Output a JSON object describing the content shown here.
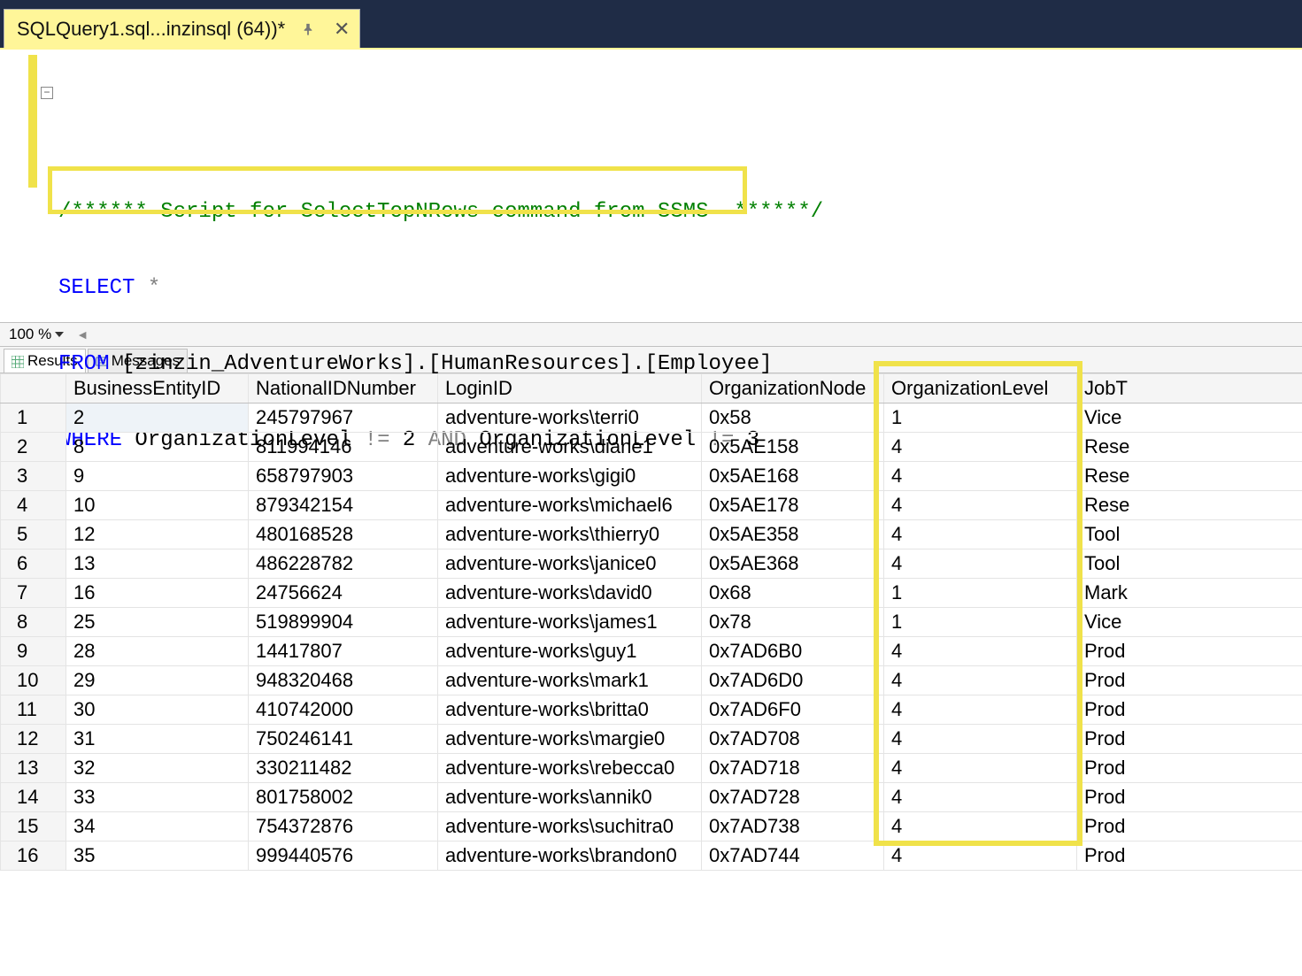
{
  "tab": {
    "title": "SQLQuery1.sql...inzinsql (64))*"
  },
  "editor": {
    "comment": "/****** Script for SelectTopNRows command from SSMS  ******/",
    "select_kw": "SELECT",
    "star": " *",
    "from_kw": "FROM",
    "from_rest": " [zinzin_AdventureWorks].[HumanResources].[Employee]",
    "where_kw": "WHERE",
    "where_p1": " OrganizationLevel ",
    "where_op1": "!=",
    "where_v1": " 2 ",
    "and_kw": "AND",
    "where_p2": " OrganizationLevel ",
    "where_op2": "!=",
    "where_v2": " 3"
  },
  "zoom": {
    "value": "100 %"
  },
  "tabs": {
    "results": "Results",
    "messages": "Messages"
  },
  "grid": {
    "headers": [
      "BusinessEntityID",
      "NationalIDNumber",
      "LoginID",
      "OrganizationNode",
      "OrganizationLevel",
      "JobT"
    ],
    "rows": [
      {
        "n": "1",
        "cells": [
          "2",
          "245797967",
          "adventure-works\\terri0",
          "0x58",
          "1",
          "Vice "
        ]
      },
      {
        "n": "2",
        "cells": [
          "8",
          "811994146",
          "adventure-works\\diane1",
          "0x5AE158",
          "4",
          "Rese"
        ]
      },
      {
        "n": "3",
        "cells": [
          "9",
          "658797903",
          "adventure-works\\gigi0",
          "0x5AE168",
          "4",
          "Rese"
        ]
      },
      {
        "n": "4",
        "cells": [
          "10",
          "879342154",
          "adventure-works\\michael6",
          "0x5AE178",
          "4",
          "Rese"
        ]
      },
      {
        "n": "5",
        "cells": [
          "12",
          "480168528",
          "adventure-works\\thierry0",
          "0x5AE358",
          "4",
          "Tool "
        ]
      },
      {
        "n": "6",
        "cells": [
          "13",
          "486228782",
          "adventure-works\\janice0",
          "0x5AE368",
          "4",
          "Tool "
        ]
      },
      {
        "n": "7",
        "cells": [
          "16",
          "24756624",
          "adventure-works\\david0",
          "0x68",
          "1",
          "Mark"
        ]
      },
      {
        "n": "8",
        "cells": [
          "25",
          "519899904",
          "adventure-works\\james1",
          "0x78",
          "1",
          "Vice "
        ]
      },
      {
        "n": "9",
        "cells": [
          "28",
          "14417807",
          "adventure-works\\guy1",
          "0x7AD6B0",
          "4",
          "Prod"
        ]
      },
      {
        "n": "10",
        "cells": [
          "29",
          "948320468",
          "adventure-works\\mark1",
          "0x7AD6D0",
          "4",
          "Prod"
        ]
      },
      {
        "n": "11",
        "cells": [
          "30",
          "410742000",
          "adventure-works\\britta0",
          "0x7AD6F0",
          "4",
          "Prod"
        ]
      },
      {
        "n": "12",
        "cells": [
          "31",
          "750246141",
          "adventure-works\\margie0",
          "0x7AD708",
          "4",
          "Prod"
        ]
      },
      {
        "n": "13",
        "cells": [
          "32",
          "330211482",
          "adventure-works\\rebecca0",
          "0x7AD718",
          "4",
          "Prod"
        ]
      },
      {
        "n": "14",
        "cells": [
          "33",
          "801758002",
          "adventure-works\\annik0",
          "0x7AD728",
          "4",
          "Prod"
        ]
      },
      {
        "n": "15",
        "cells": [
          "34",
          "754372876",
          "adventure-works\\suchitra0",
          "0x7AD738",
          "4",
          "Prod"
        ]
      },
      {
        "n": "16",
        "cells": [
          "35",
          "999440576",
          "adventure-works\\brandon0",
          "0x7AD744",
          "4",
          "Prod"
        ]
      }
    ]
  }
}
